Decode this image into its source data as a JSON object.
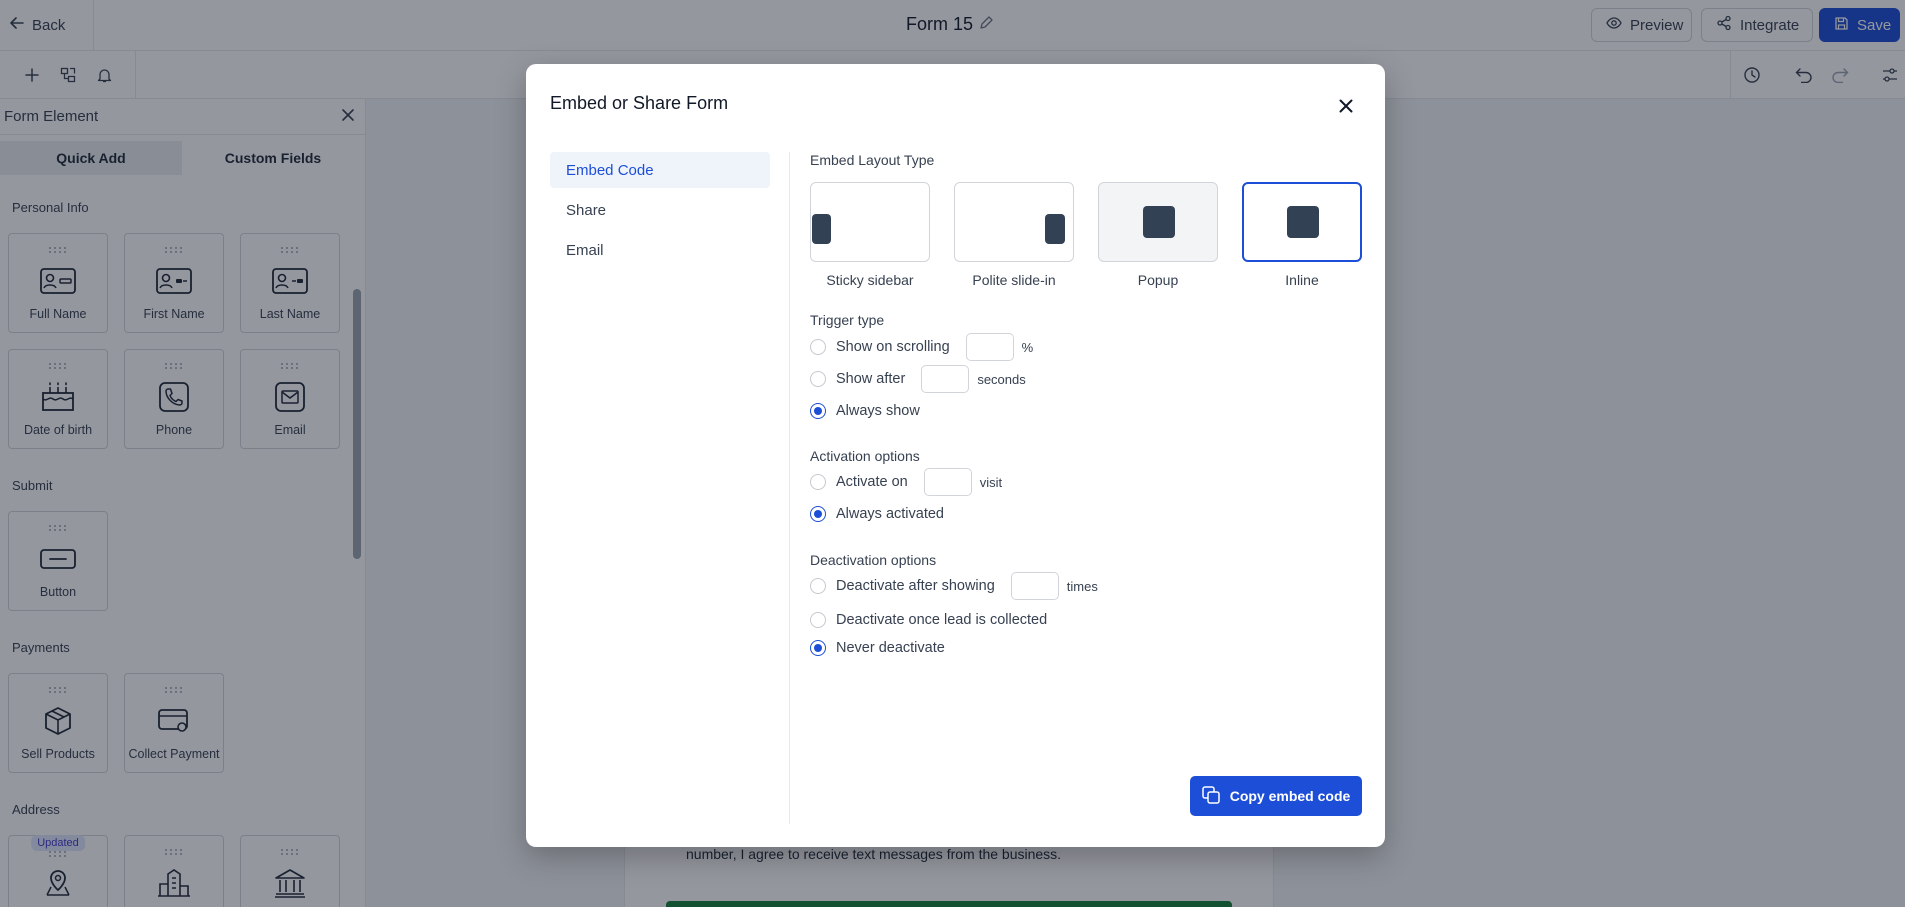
{
  "header": {
    "back_label": "Back",
    "form_title": "Form 15",
    "preview_label": "Preview",
    "integrate_label": "Integrate",
    "save_label": "Save"
  },
  "left_panel": {
    "title": "Form Element",
    "tabs": [
      "Quick Add",
      "Custom Fields"
    ],
    "sections": {
      "personal_info": "Personal Info",
      "submit": "Submit",
      "payments": "Payments",
      "address": "Address"
    },
    "tiles": {
      "full_name": "Full Name",
      "first_name": "First Name",
      "last_name": "Last Name",
      "date_of_birth": "Date of birth",
      "phone": "Phone",
      "email": "Email",
      "button": "Button",
      "sell_products": "Sell Products",
      "collect_payment": "Collect Payment",
      "updated_badge": "Updated"
    }
  },
  "canvas": {
    "consent_text": "number, I agree to receive text messages from the business."
  },
  "modal": {
    "title": "Embed or Share Form",
    "nav": [
      "Embed Code",
      "Share",
      "Email"
    ],
    "embed_layout_type_label": "Embed Layout Type",
    "layouts": [
      "Sticky sidebar",
      "Polite slide-in",
      "Popup",
      "Inline"
    ],
    "selected_layout": "Inline",
    "trigger": {
      "label": "Trigger type",
      "scrolling": "Show on scrolling",
      "scrolling_unit": "%",
      "after": "Show after",
      "after_unit": "seconds",
      "always": "Always show",
      "selected": "Always show"
    },
    "activation": {
      "label": "Activation options",
      "activate_on": "Activate on",
      "activate_unit": "visit",
      "always": "Always activated",
      "selected": "Always activated"
    },
    "deactivation": {
      "label": "Deactivation options",
      "after_showing": "Deactivate after showing",
      "after_showing_unit": "times",
      "once_lead": "Deactivate once lead is collected",
      "never": "Never deactivate",
      "selected": "Never deactivate"
    },
    "copy_button": "Copy embed code"
  },
  "colors": {
    "accent": "#1d4ed8",
    "overlay": "#111827",
    "layout_mark": "#334155",
    "submit_green": "#15803d"
  }
}
